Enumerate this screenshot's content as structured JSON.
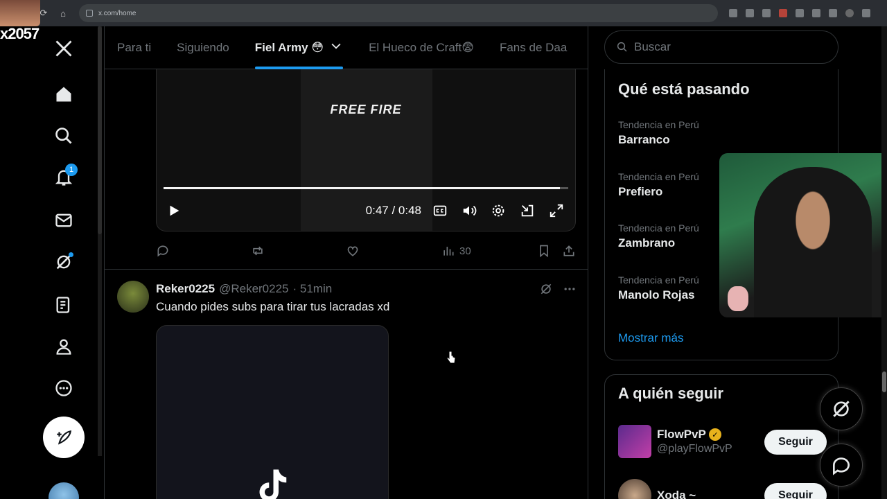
{
  "browser": {
    "url": "x.com/home"
  },
  "overlay": {
    "counter": "x2057"
  },
  "nav": {
    "notifications_badge": "1"
  },
  "tabs": [
    {
      "label": "Para ti"
    },
    {
      "label": "Siguiendo"
    },
    {
      "label": "Fiel Army 😳",
      "active": true
    },
    {
      "label": "El Hueco de Craft😨"
    },
    {
      "label": "Fans de Daa"
    }
  ],
  "video": {
    "brand_text": "FREE FIRE",
    "time": "0:47 / 0:48",
    "progress": 0.979
  },
  "tweet1_actions": {
    "views": "30"
  },
  "tweet2": {
    "name": "Reker0225",
    "handle": "@Reker0225",
    "time": "· 51min",
    "text": "Cuando pides subs para tirar tus lacradas xd"
  },
  "sidebar": {
    "search_placeholder": "Buscar",
    "trends_title": "Qué está pasando",
    "trends": [
      {
        "meta": "Tendencia en Perú",
        "name": "Barranco"
      },
      {
        "meta": "Tendencia en Perú",
        "name": "Prefiero"
      },
      {
        "meta": "Tendencia en Perú",
        "name": "Zambrano"
      },
      {
        "meta": "Tendencia en Perú",
        "name": "Manolo Rojas"
      }
    ],
    "show_more": "Mostrar más",
    "who_to_follow_title": "A quién seguir",
    "suggestions": [
      {
        "name": "FlowPvP",
        "handle": "@playFlowPvP",
        "follow_label": "Seguir",
        "verified": true
      },
      {
        "name": "Xoda ~",
        "handle": "",
        "follow_label": "Seguir",
        "verified": false
      }
    ]
  },
  "colors": {
    "accent": "#1d9bf0",
    "background": "#000000",
    "border": "#2f3336",
    "muted_text": "#71767b"
  }
}
